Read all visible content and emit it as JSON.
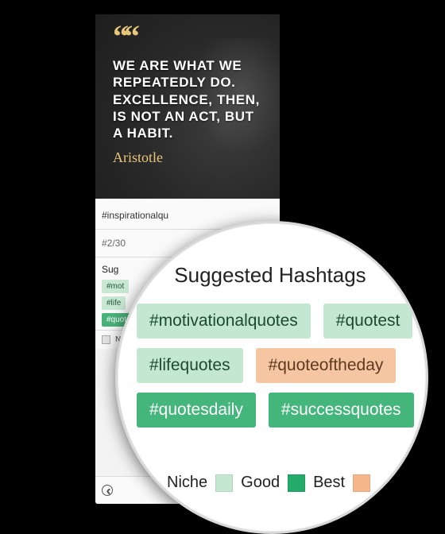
{
  "quote": {
    "mark": "““",
    "text": "WE ARE WHAT WE REPEATEDLY DO. EXCELLENCE, THEN, IS NOT AN ACT, BUT A HABIT.",
    "author": "Aristotle"
  },
  "caption": "#inspirationalqu",
  "hashtag_count": "#2/30",
  "suggested_small": {
    "title": "Sug",
    "tags": [
      {
        "label": "#mot",
        "tier": "good"
      },
      {
        "label": "#life",
        "tier": "good"
      },
      {
        "label": "#quote",
        "tier": "best"
      }
    ]
  },
  "legend_small": {
    "niche": "Niche"
  },
  "suggested": {
    "title": "Suggested Hashtags",
    "rows": [
      [
        {
          "label": "#motivationalquotes",
          "tier": "good"
        },
        {
          "label": "#quotest",
          "tier": "good"
        }
      ],
      [
        {
          "label": "#lifequotes",
          "tier": "good"
        },
        {
          "label": "#quoteoftheday",
          "tier": "comp"
        }
      ],
      [
        {
          "label": "#quotesdaily",
          "tier": "best"
        },
        {
          "label": "#successquotes",
          "tier": "best"
        }
      ]
    ]
  },
  "legend": {
    "niche": "Niche",
    "good": "Good",
    "best": "Best"
  },
  "colors": {
    "good": "#c3e7d0",
    "best": "#24aa6a",
    "comp": "#f6b88b",
    "niche": "#e3e3e3"
  }
}
